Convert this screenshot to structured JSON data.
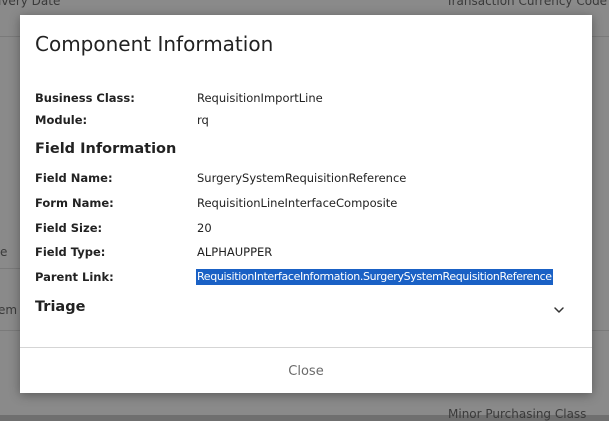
{
  "background": {
    "texts": [
      {
        "id": "bg-delivery-date",
        "text": "ivery Date"
      },
      {
        "id": "bg-transaction-currency",
        "text": "Transaction Currency Code"
      },
      {
        "id": "bg-e",
        "text": "e"
      },
      {
        "id": "bg-em-r",
        "text": "em R"
      },
      {
        "id": "bg-minor-purchasing",
        "text": "Minor Purchasing Class"
      }
    ]
  },
  "modal": {
    "title": "Component Information",
    "general": [
      {
        "label": "Business Class:",
        "value": "RequisitionImportLine"
      },
      {
        "label": "Module:",
        "value": "rq"
      }
    ],
    "field_section_title": "Field Information",
    "fields": [
      {
        "label": "Field Name:",
        "value": "SurgerySystemRequisitionReference"
      },
      {
        "label": "Form Name:",
        "value": "RequisitionLineInterfaceComposite"
      },
      {
        "label": "Field Size:",
        "value": "20"
      },
      {
        "label": "Field Type:",
        "value": "ALPHAUPPER"
      },
      {
        "label": "Parent Link:",
        "value": "RequisitionInterfaceInformation.SurgerySystemRequisitionReference",
        "selected": true
      }
    ],
    "triage_title": "Triage",
    "triage_icon": "chevron-down-icon",
    "close_label": "Close"
  },
  "colors": {
    "selection": "#1a61c5",
    "overlay": "#8a8a8a"
  }
}
